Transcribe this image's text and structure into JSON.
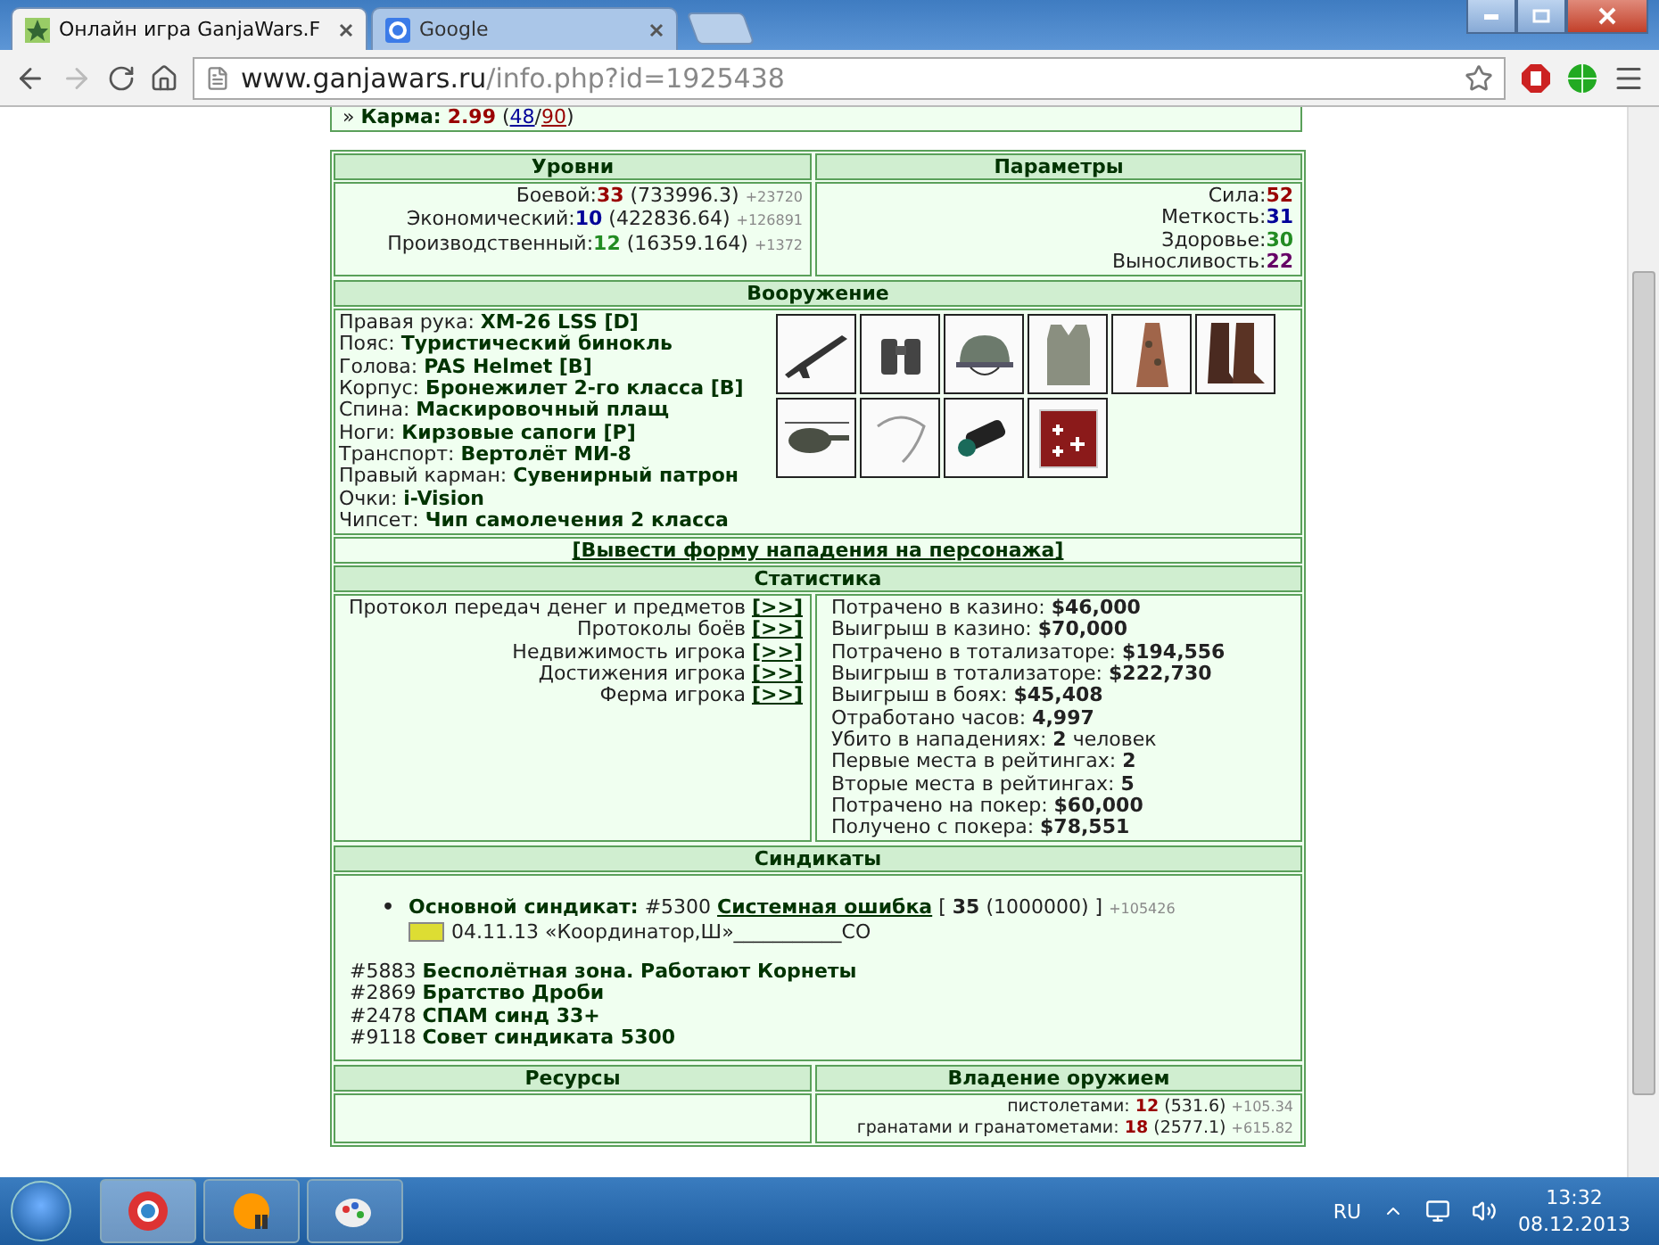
{
  "browser": {
    "tabs": [
      {
        "title": "Онлайн игра GanjaWars.F",
        "selected": true,
        "kind": "game"
      },
      {
        "title": "Google",
        "selected": false,
        "kind": "google"
      }
    ],
    "address": {
      "host": "www.ganjawars.ru",
      "path": "/info.php?id=1925438"
    }
  },
  "karma": {
    "marker": "»",
    "label": "Карма:",
    "value": "2.99",
    "open": "(",
    "plus": "48",
    "sep": "/",
    "minus": "90",
    "close": ")"
  },
  "levels": {
    "title": "Уровни",
    "rows": [
      {
        "label": "Боевой:",
        "value": "33",
        "color": "#990000",
        "points": "(733996.3)",
        "gain": "+23720"
      },
      {
        "label": "Экономический:",
        "value": "10",
        "color": "#000099",
        "points": "(422836.64)",
        "gain": "+126891"
      },
      {
        "label": "Производственный:",
        "value": "12",
        "color": "#228b22",
        "points": "(16359.164)",
        "gain": "+1372"
      }
    ]
  },
  "params": {
    "title": "Параметры",
    "rows": [
      {
        "label": "Сила:",
        "value": "52",
        "color": "#990000"
      },
      {
        "label": "Меткость:",
        "value": "31",
        "color": "#000099"
      },
      {
        "label": "Здоровье:",
        "value": "30",
        "color": "#228b22"
      },
      {
        "label": "Выносливость:",
        "value": "22",
        "color": "#660066"
      }
    ]
  },
  "equipment": {
    "title": "Вооружение",
    "slots": [
      {
        "slot": "Правая рука:",
        "item": "XM-26 LSS [D]"
      },
      {
        "slot": "Пояс:",
        "item": "Туристический бинокль"
      },
      {
        "slot": "Голова:",
        "item": "PAS Helmet [B]"
      },
      {
        "slot": "Корпус:",
        "item": "Бронежилет 2-го класса [B]"
      },
      {
        "slot": "Спина:",
        "item": "Маскировочный плащ"
      },
      {
        "slot": "Ноги:",
        "item": "Кирзовые сапоги [P]"
      },
      {
        "slot": "Транспорт:",
        "item": "Вертолёт МИ-8"
      },
      {
        "slot": "Правый карман:",
        "item": "Сувенирный патрон"
      },
      {
        "slot": "Очки:",
        "item": "i-Vision"
      },
      {
        "slot": "Чипсет:",
        "item": "Чип самолечения 2 класса"
      }
    ]
  },
  "attack_link": "[Вывести форму нападения на персонажа]",
  "statistics": {
    "title": "Статистика",
    "links": [
      {
        "label": "Протокол передач денег и предметов",
        "button": "[>>]"
      },
      {
        "label": "Протоколы боёв",
        "button": "[>>]"
      },
      {
        "label": "Недвижимость игрока",
        "button": "[>>]"
      },
      {
        "label": "Достижения игрока",
        "button": "[>>]"
      },
      {
        "label": "Ферма игрока",
        "button": "[>>]"
      }
    ],
    "facts": [
      {
        "text": "Потрачено в казино: **$46,000**"
      },
      {
        "text": "Выигрыш в казино: **$70,000**"
      },
      {
        "text": "Потрачено в тотализаторе: **$194,556**"
      },
      {
        "text": "Выигрыш в тотализаторе: **$222,730**"
      },
      {
        "text": "Выигрыш в боях: **$45,408**"
      },
      {
        "text": "Отработано часов: **4,997**"
      },
      {
        "text": "Убито в нападениях: **2** человек"
      },
      {
        "text": "Первые места в рейтингах: **2**"
      },
      {
        "text": "Вторые места в рейтингах: **5**"
      },
      {
        "text": "Потрачено на покер: **$60,000**"
      },
      {
        "text": "Получено с покера: **$78,551**"
      }
    ]
  },
  "syndicates": {
    "title": "Синдикаты",
    "main": {
      "bullet": "•",
      "label": "Основной синдикат:",
      "id": "#5300",
      "name": "Системная ошибка",
      "level": "[ **35** (1000000) ]",
      "gain": "+105426",
      "date": "04.11.13",
      "role": "«Координатор,Ш»___________СО"
    },
    "list": [
      {
        "id": "#5883",
        "name": "Бесполётная зона. Работают Корнеты"
      },
      {
        "id": "#2869",
        "name": "Братство Дроби"
      },
      {
        "id": "#2478",
        "name": "СПАМ синд 33+"
      },
      {
        "id": "#9118",
        "name": "Совет синдиката 5300"
      }
    ]
  },
  "resources": {
    "title": "Ресурсы"
  },
  "weapon_skills": {
    "title": "Владение оружием",
    "rows": [
      {
        "label": "пистолетами:",
        "value": "12",
        "points": "(531.6)",
        "gain": "+105.34"
      },
      {
        "label": "гранатами и гранатометами:",
        "value": "18",
        "points": "(2577.1)",
        "gain": "+615.82"
      }
    ]
  },
  "taskbar": {
    "lang": "RU",
    "time": "13:32",
    "date": "08.12.2013"
  }
}
